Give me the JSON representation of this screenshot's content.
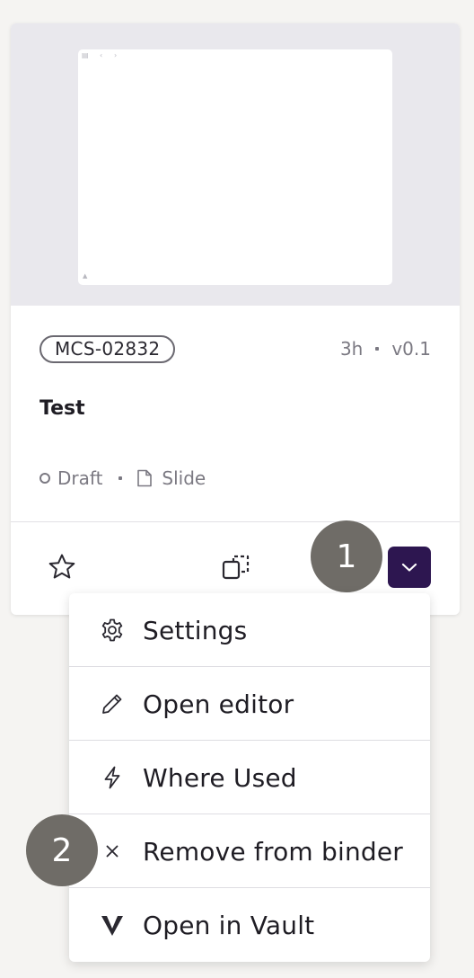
{
  "card": {
    "code": "MCS-02832",
    "age": "3h",
    "version": "v0.1",
    "title": "Test",
    "status": "Draft",
    "doc_type": "Slide"
  },
  "thumbnail": {
    "mini_icons": [
      "▤",
      "‹",
      "›",
      "▲"
    ]
  },
  "actions": {
    "favorite_icon": "star-icon",
    "copy_icon": "copy-icon",
    "dropdown_icon": "chevron-down-icon",
    "dropdown_color": "#2d1650"
  },
  "step_badges": [
    "1",
    "2"
  ],
  "menu": {
    "items": [
      {
        "label": "Settings",
        "icon": "gear-icon"
      },
      {
        "label": "Open editor",
        "icon": "pencil-icon"
      },
      {
        "label": "Where Used",
        "icon": "lightning-icon"
      },
      {
        "label": "Remove from binder",
        "icon": "close-icon"
      },
      {
        "label": "Open in Vault",
        "icon": "vault-icon"
      }
    ]
  }
}
